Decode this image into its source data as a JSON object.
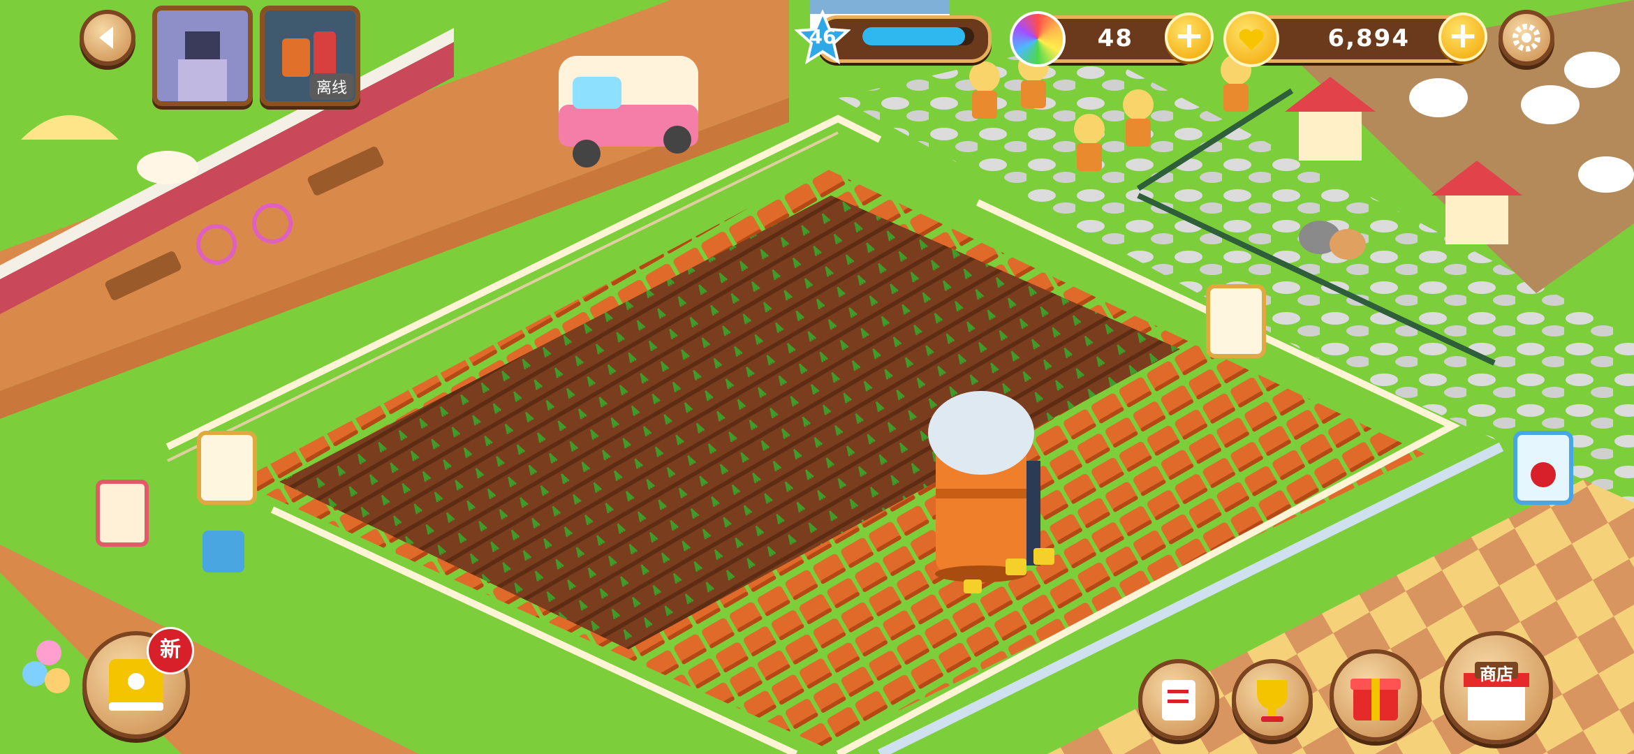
{
  "hud": {
    "level": "46",
    "xp_progress": 0.92,
    "gems": "48",
    "coins": "6,894",
    "offline_label": "离线",
    "new_badge": "新",
    "shop_label": "商店"
  },
  "icons": {
    "back": "back-icon",
    "settings": "gear-icon",
    "gem": "rainbow-gem-icon",
    "coin": "heart-coin-icon",
    "star": "level-star-icon",
    "plus": "plus-icon",
    "book": "recipe-book-icon",
    "notepad": "notepad-icon",
    "trophy": "trophy-icon",
    "gift": "gift-icon",
    "shop": "shop-icon"
  },
  "colors": {
    "grass": "#7ccf3a",
    "soil": "#7a3e1e",
    "plot": "#e06a2a",
    "fence": "#fff4d6",
    "path": "#d98a4a",
    "hud_brown": "#6b3a1c",
    "hud_gold": "#f2a400",
    "xp_blue": "#2fb8f0"
  }
}
